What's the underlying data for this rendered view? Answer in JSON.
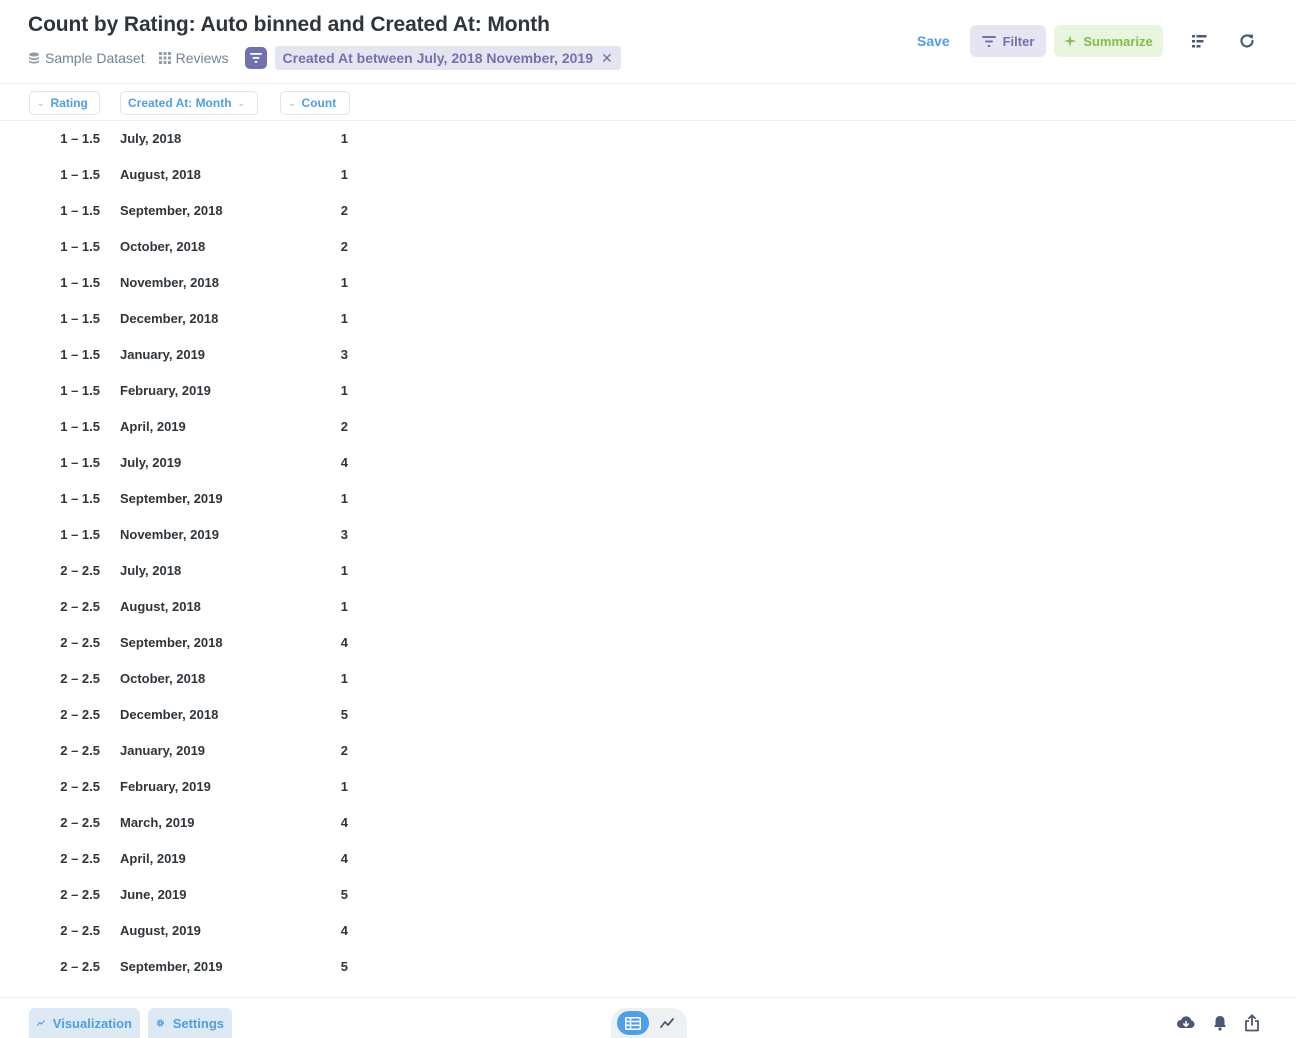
{
  "header": {
    "title": "Count by Rating: Auto binned and Created At: Month",
    "breadcrumbs": [
      {
        "label": "Sample Dataset",
        "icon": "database-icon"
      },
      {
        "label": "Reviews",
        "icon": "table-grid-icon"
      }
    ],
    "filter_chip": "Created At between July, 2018 November, 2019",
    "actions": {
      "save_label": "Save",
      "filter_label": "Filter",
      "summarize_label": "Summarize"
    }
  },
  "columns": [
    {
      "label": "Rating"
    },
    {
      "label": "Created At: Month"
    },
    {
      "label": "Count"
    }
  ],
  "rows": [
    {
      "rating": "1 – 1.5",
      "month": "July, 2018",
      "count": "1"
    },
    {
      "rating": "1 – 1.5",
      "month": "August, 2018",
      "count": "1"
    },
    {
      "rating": "1 – 1.5",
      "month": "September, 2018",
      "count": "2"
    },
    {
      "rating": "1 – 1.5",
      "month": "October, 2018",
      "count": "2"
    },
    {
      "rating": "1 – 1.5",
      "month": "November, 2018",
      "count": "1"
    },
    {
      "rating": "1 – 1.5",
      "month": "December, 2018",
      "count": "1"
    },
    {
      "rating": "1 – 1.5",
      "month": "January, 2019",
      "count": "3"
    },
    {
      "rating": "1 – 1.5",
      "month": "February, 2019",
      "count": "1"
    },
    {
      "rating": "1 – 1.5",
      "month": "April, 2019",
      "count": "2"
    },
    {
      "rating": "1 – 1.5",
      "month": "July, 2019",
      "count": "4"
    },
    {
      "rating": "1 – 1.5",
      "month": "September, 2019",
      "count": "1"
    },
    {
      "rating": "1 – 1.5",
      "month": "November, 2019",
      "count": "3"
    },
    {
      "rating": "2 – 2.5",
      "month": "July, 2018",
      "count": "1"
    },
    {
      "rating": "2 – 2.5",
      "month": "August, 2018",
      "count": "1"
    },
    {
      "rating": "2 – 2.5",
      "month": "September, 2018",
      "count": "4"
    },
    {
      "rating": "2 – 2.5",
      "month": "October, 2018",
      "count": "1"
    },
    {
      "rating": "2 – 2.5",
      "month": "December, 2018",
      "count": "5"
    },
    {
      "rating": "2 – 2.5",
      "month": "January, 2019",
      "count": "2"
    },
    {
      "rating": "2 – 2.5",
      "month": "February, 2019",
      "count": "1"
    },
    {
      "rating": "2 – 2.5",
      "month": "March, 2019",
      "count": "4"
    },
    {
      "rating": "2 – 2.5",
      "month": "April, 2019",
      "count": "4"
    },
    {
      "rating": "2 – 2.5",
      "month": "June, 2019",
      "count": "5"
    },
    {
      "rating": "2 – 2.5",
      "month": "August, 2019",
      "count": "4"
    },
    {
      "rating": "2 – 2.5",
      "month": "September, 2019",
      "count": "5"
    }
  ],
  "footer": {
    "visualization_label": "Visualization",
    "settings_label": "Settings"
  },
  "colors": {
    "brand": "#509ee3",
    "filter": "#7172ad",
    "summarize": "#84bb4c",
    "text": "#2e353b"
  }
}
